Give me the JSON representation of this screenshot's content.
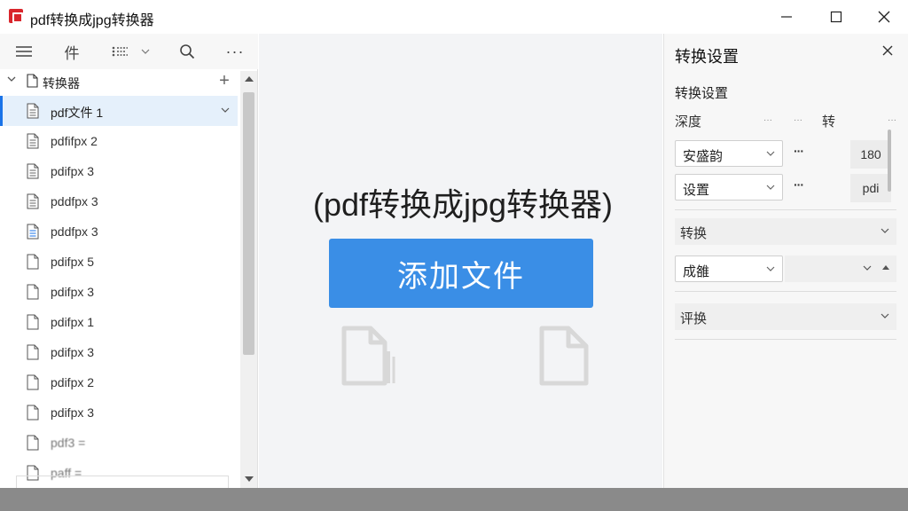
{
  "window": {
    "title": "pdf转换成jpg转换器",
    "minimize_icon": "minimize-icon",
    "maximize_icon": "maximize-icon",
    "close_icon": "close-icon"
  },
  "toolbar": {
    "doc_label": "件",
    "more_label": "···",
    "filter_caret": "⌄"
  },
  "tree": {
    "root_label": "转换器",
    "add_label": "+"
  },
  "files": [
    {
      "label": "pdf文件 1",
      "selected": true
    },
    {
      "label": "pdfifpx 2"
    },
    {
      "label": "pdifpx 3"
    },
    {
      "label": "pddfpx 3"
    },
    {
      "label": "pddfpx 3"
    },
    {
      "label": "pdifpx 5"
    },
    {
      "label": "pdifpx 3"
    },
    {
      "label": "pdifpx 1"
    },
    {
      "label": "pdifpx 3"
    },
    {
      "label": "pdifpx 2"
    },
    {
      "label": "pdifpx 3"
    },
    {
      "label": "pdf3 ="
    },
    {
      "label": "paff ="
    }
  ],
  "center": {
    "title": "(pdf转换成jpg转换器)",
    "add_file_label": "添加文件"
  },
  "settings": {
    "panel_title": "转换设置",
    "section_label": "转换设置",
    "col_a": "深度",
    "col_b": "···",
    "col_c": "···",
    "col_d": "转",
    "col_e": "···",
    "select1_value": "安盛韵",
    "select2_value": "设置",
    "dots1": "···",
    "dots2": "···",
    "value1": "180",
    "value2": "pdi",
    "collapse1_label": "转换",
    "select3_value": "成雒",
    "collapse2_label": "评换"
  },
  "colors": {
    "accent": "#3a8ee6",
    "selection": "#e5f0fb",
    "app_icon": "#d9262c"
  }
}
